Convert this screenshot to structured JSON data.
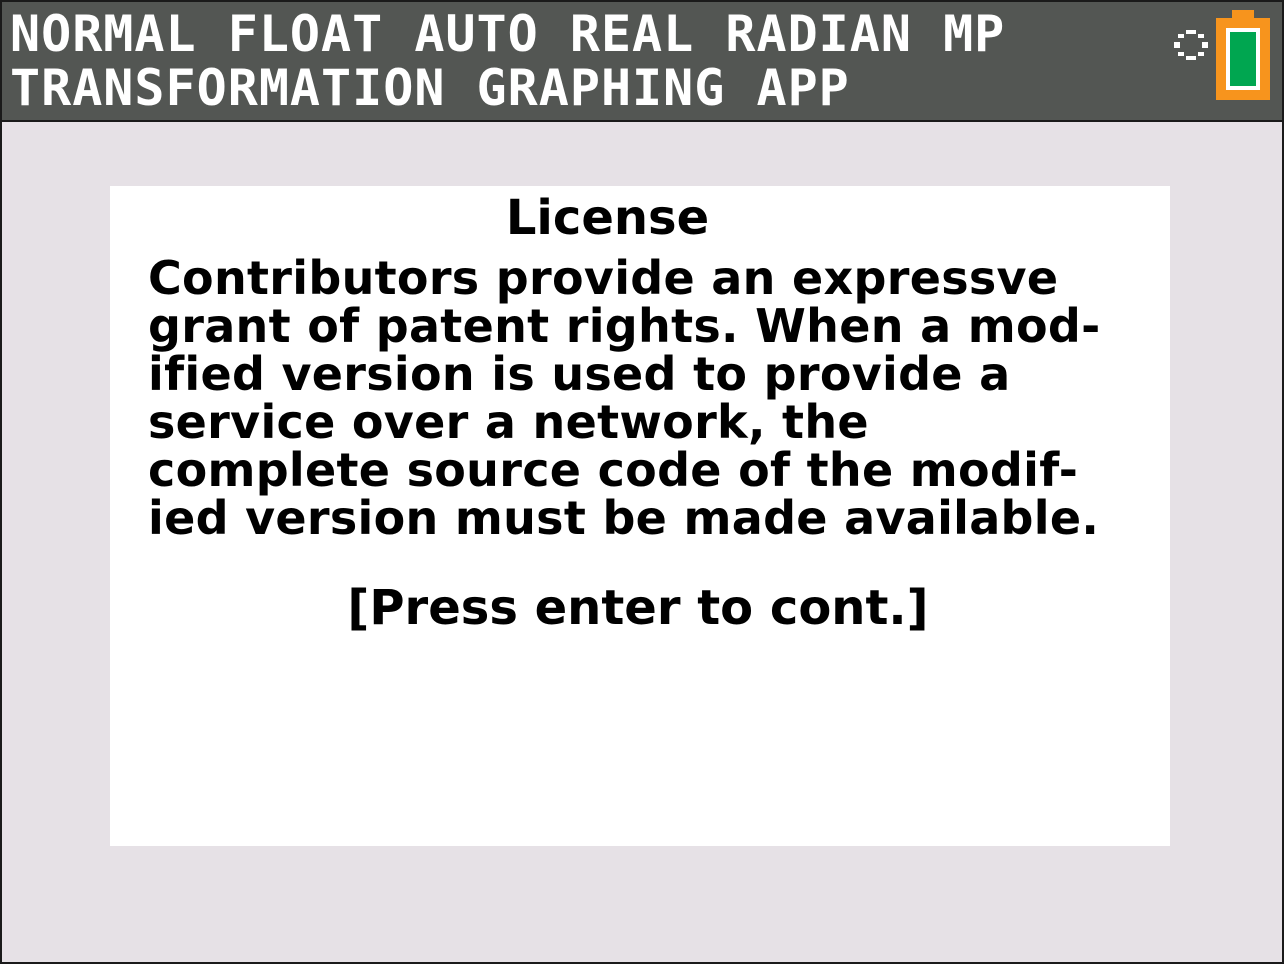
{
  "status_bar": {
    "mode_line": "NORMAL FLOAT AUTO REAL RADIAN MP",
    "app_line": "TRANSFORMATION GRAPHING APP",
    "busy_indicator_icon": "busy-indicator-icon",
    "battery_icon": "battery-icon",
    "battery_level": 1.0,
    "colors": {
      "bar": "#535653",
      "battery_frame": "#f7941d",
      "battery_fill": "#00a650"
    }
  },
  "dialog": {
    "title": "License",
    "lines": [
      "Contributors provide an expressve",
      "grant of patent rights. When a mod-",
      "ified version is used to provide a",
      "service over a network, the",
      "complete source code of the modif-",
      "ied version must be made available."
    ],
    "continue_hint": "[Press enter to cont.]"
  },
  "colors": {
    "screen_background": "#e6e1e6",
    "dialog_background": "#ffffff"
  }
}
